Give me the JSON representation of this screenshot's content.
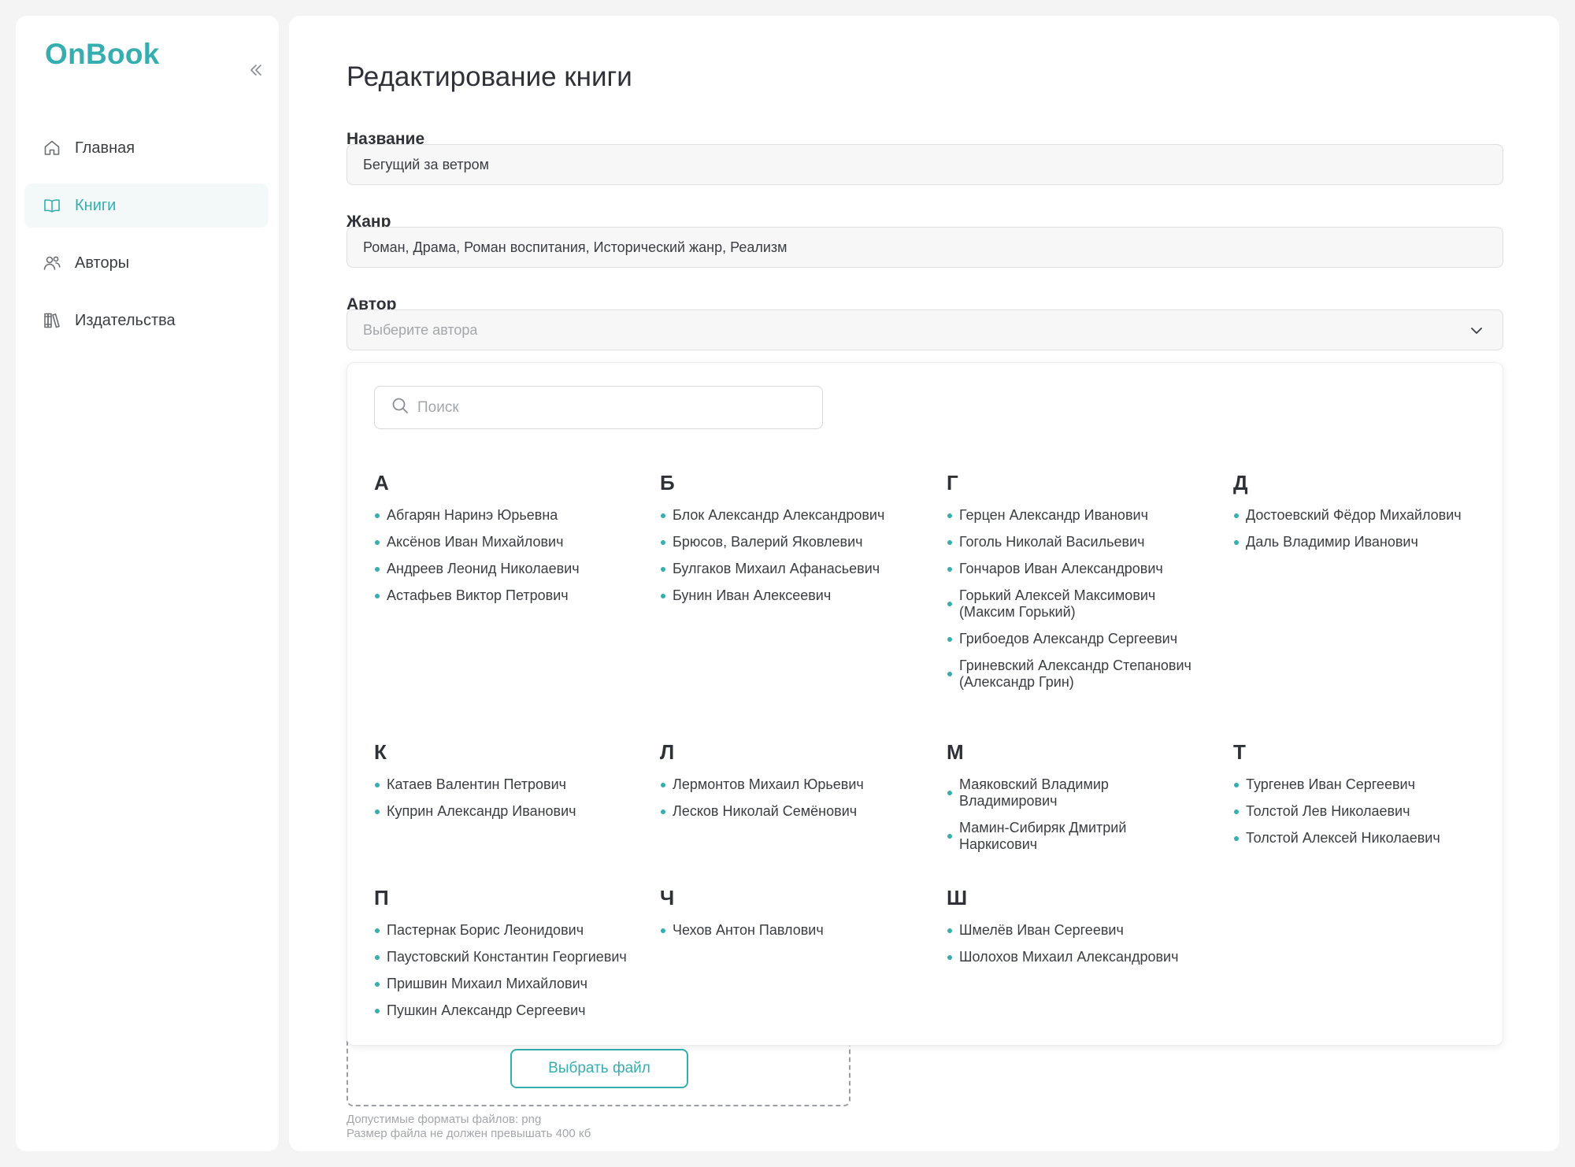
{
  "app": {
    "logo": "OnBook"
  },
  "sidebar": {
    "items": [
      {
        "label": "Главная",
        "icon": "home-icon",
        "active": false
      },
      {
        "label": "Книги",
        "icon": "book-icon",
        "active": true
      },
      {
        "label": "Авторы",
        "icon": "users-icon",
        "active": false
      },
      {
        "label": "Издательства",
        "icon": "library-icon",
        "active": false
      }
    ]
  },
  "page": {
    "title": "Редактирование книги",
    "fields": {
      "name": {
        "label": "Название",
        "value": "Бегущий за ветром"
      },
      "genre": {
        "label": "Жанр",
        "value": "Роман, Драма, Роман воспитания, Исторический жанр, Реализм"
      },
      "author": {
        "label": "Автор",
        "placeholder": "Выберите автора"
      }
    },
    "upload": {
      "button_label": "Выбрать файл",
      "hint_formats": "Допустимые форматы файлов: png",
      "hint_size": "Размер файла не должен превышать 400 кб"
    }
  },
  "dropdown": {
    "search_placeholder": "Поиск",
    "groups": [
      {
        "letter": "А",
        "authors": [
          "Абгарян Наринэ Юрьевна",
          "Аксёнов Иван Михайлович",
          "Андреев Леонид Николаевич",
          "Астафьев Виктор Петрович"
        ]
      },
      {
        "letter": "Б",
        "authors": [
          "Блок Александр Александрович",
          "Брюсов, Валерий Яковлевич",
          "Булгаков Михаил Афанасьевич",
          "Бунин Иван Алексеевич"
        ]
      },
      {
        "letter": "Г",
        "authors": [
          "Герцен Александр Иванович",
          "Гоголь Николай Васильевич",
          "Гончаров Иван Александрович",
          "Горький Алексей Максимович (Максим Горький)",
          "Грибоедов Александр Сергеевич",
          "Гриневский Александр Степанович (Александр Грин)"
        ]
      },
      {
        "letter": "Д",
        "authors": [
          "Достоевский Фёдор Михайлович",
          "Даль Владимир Иванович"
        ]
      },
      {
        "letter": "К",
        "authors": [
          "Катаев Валентин Петрович",
          "Куприн Александр Иванович"
        ]
      },
      {
        "letter": "Л",
        "authors": [
          "Лермонтов Михаил Юрьевич",
          "Лесков Николай Семёнович"
        ]
      },
      {
        "letter": "М",
        "authors": [
          "Маяковский Владимир Владимирович",
          "Мамин-Сибиряк Дмитрий Наркисович"
        ]
      },
      {
        "letter": "Т",
        "authors": [
          "Тургенев Иван Сергеевич",
          "Толстой Лев Николаевич",
          "Толстой Алексей Николаевич"
        ]
      },
      {
        "letter": "П",
        "authors": [
          "Пастернак Борис Леонидович",
          "Паустовский Константин Георгиевич",
          "Пришвин Михаил Михайлович",
          "Пушкин Александр Сергеевич"
        ]
      },
      {
        "letter": "Ч",
        "authors": [
          "Чехов Антон Павлович"
        ]
      },
      {
        "letter": "Ш",
        "authors": [
          "Шмелёв Иван Сергеевич",
          "Шолохов Михаил Александрович"
        ]
      }
    ]
  },
  "colors": {
    "accent": "#36aeb0",
    "active_bg": "#f2f9f8"
  }
}
